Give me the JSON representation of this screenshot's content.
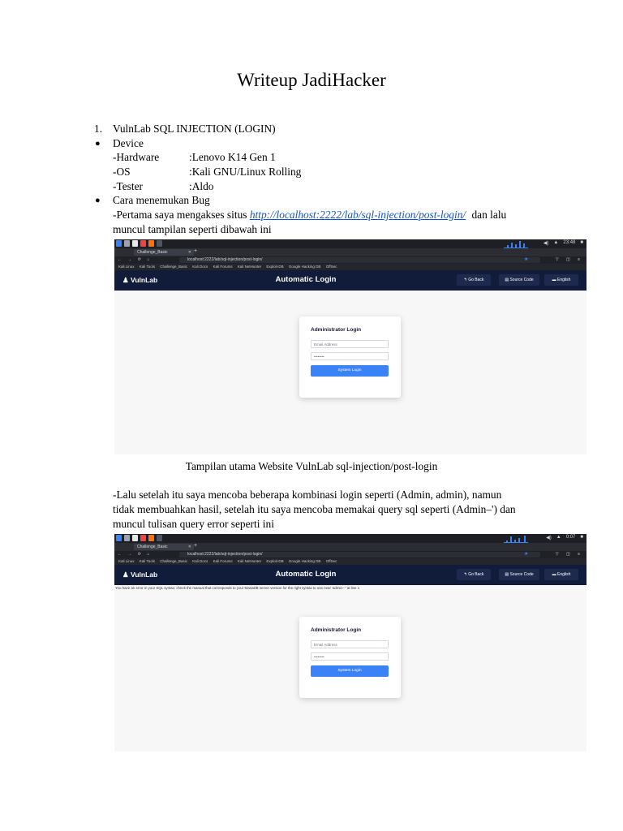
{
  "document": {
    "title": "Writeup JadiHacker",
    "item_number": "1.",
    "item_title": "VulnLab SQL INJECTION  (LOGIN)",
    "bullet": "●",
    "device": {
      "label": "Device",
      "rows": [
        {
          "key": "-Hardware",
          "value": ":Lenovo K14 Gen 1"
        },
        {
          "key": "-OS",
          "value": ":Kali GNU/Linux Rolling"
        },
        {
          "key": "-Tester",
          "value": ":Aldo"
        }
      ]
    },
    "bug": {
      "label": "Cara menemukan Bug",
      "para1_prefix": "-Pertama saya mengakses situs ",
      "para1_link": "http://localhost:2222/lab/sql-injection/post-login/",
      "para1_suffix": " dan lalu",
      "para1_line2": "muncul tampilan seperti dibawah ini",
      "caption1": "Tampilan utama Website VulnLab sql-injection/post-login",
      "para2_line1": "-Lalu setelah itu saya mencoba beberapa kombinasi login seperti (Admin, admin), namun",
      "para2_line2": "tidak membuahkan hasil, setelah itu saya mencoba memakai query sql seperti (Admin–') dan",
      "para2_line3": "muncul tulisan query error seperti ini"
    }
  },
  "screenshot1": {
    "tab_label": "Challenge_Basic",
    "url": "localhost:2222/lab/sql-injection/post-login/",
    "bookmarks": [
      "Kali Linux",
      "Kali Tools",
      "Challenge_Basic",
      "Kali Docs",
      "Kali Forums",
      "Kali NetHunter",
      "Exploit-DB",
      "Google Hacking DB",
      "OffSec"
    ],
    "clock": "23:48",
    "logo": "VulnLab",
    "app_title": "Automatic Login",
    "go_back": "Go Back",
    "source_code": "Source Code",
    "language": "English",
    "card_title": "Administrator Login",
    "email_placeholder": "Email Address",
    "password_value": "••••••••",
    "login_button": "System Login"
  },
  "screenshot2": {
    "tab_label": "Challenge_Basic",
    "url": "localhost:2222/lab/sql-injection/post-login/",
    "bookmarks": [
      "Kali Linux",
      "Kali Tools",
      "Challenge_Basic",
      "Kali Docs",
      "Kali Forums",
      "Kali NetHunter",
      "Exploit-DB",
      "Google Hacking DB",
      "OffSec"
    ],
    "clock": "0:07",
    "logo": "VulnLab",
    "app_title": "Automatic Login",
    "go_back": "Go Back",
    "source_code": "Source Code",
    "language": "English",
    "error_message": "You have an error in your SQL syntax; check the manual that corresponds to your MariaDB server version for the right syntax to use near 'admin--'' at line 1",
    "card_title": "Administrator Login",
    "email_placeholder": "Email Address",
    "password_value": "••••••••",
    "login_button": "System Login"
  },
  "colors": {
    "link": "#1155cc",
    "app_header": "#111c3b",
    "login_button": "#3b82f6"
  }
}
